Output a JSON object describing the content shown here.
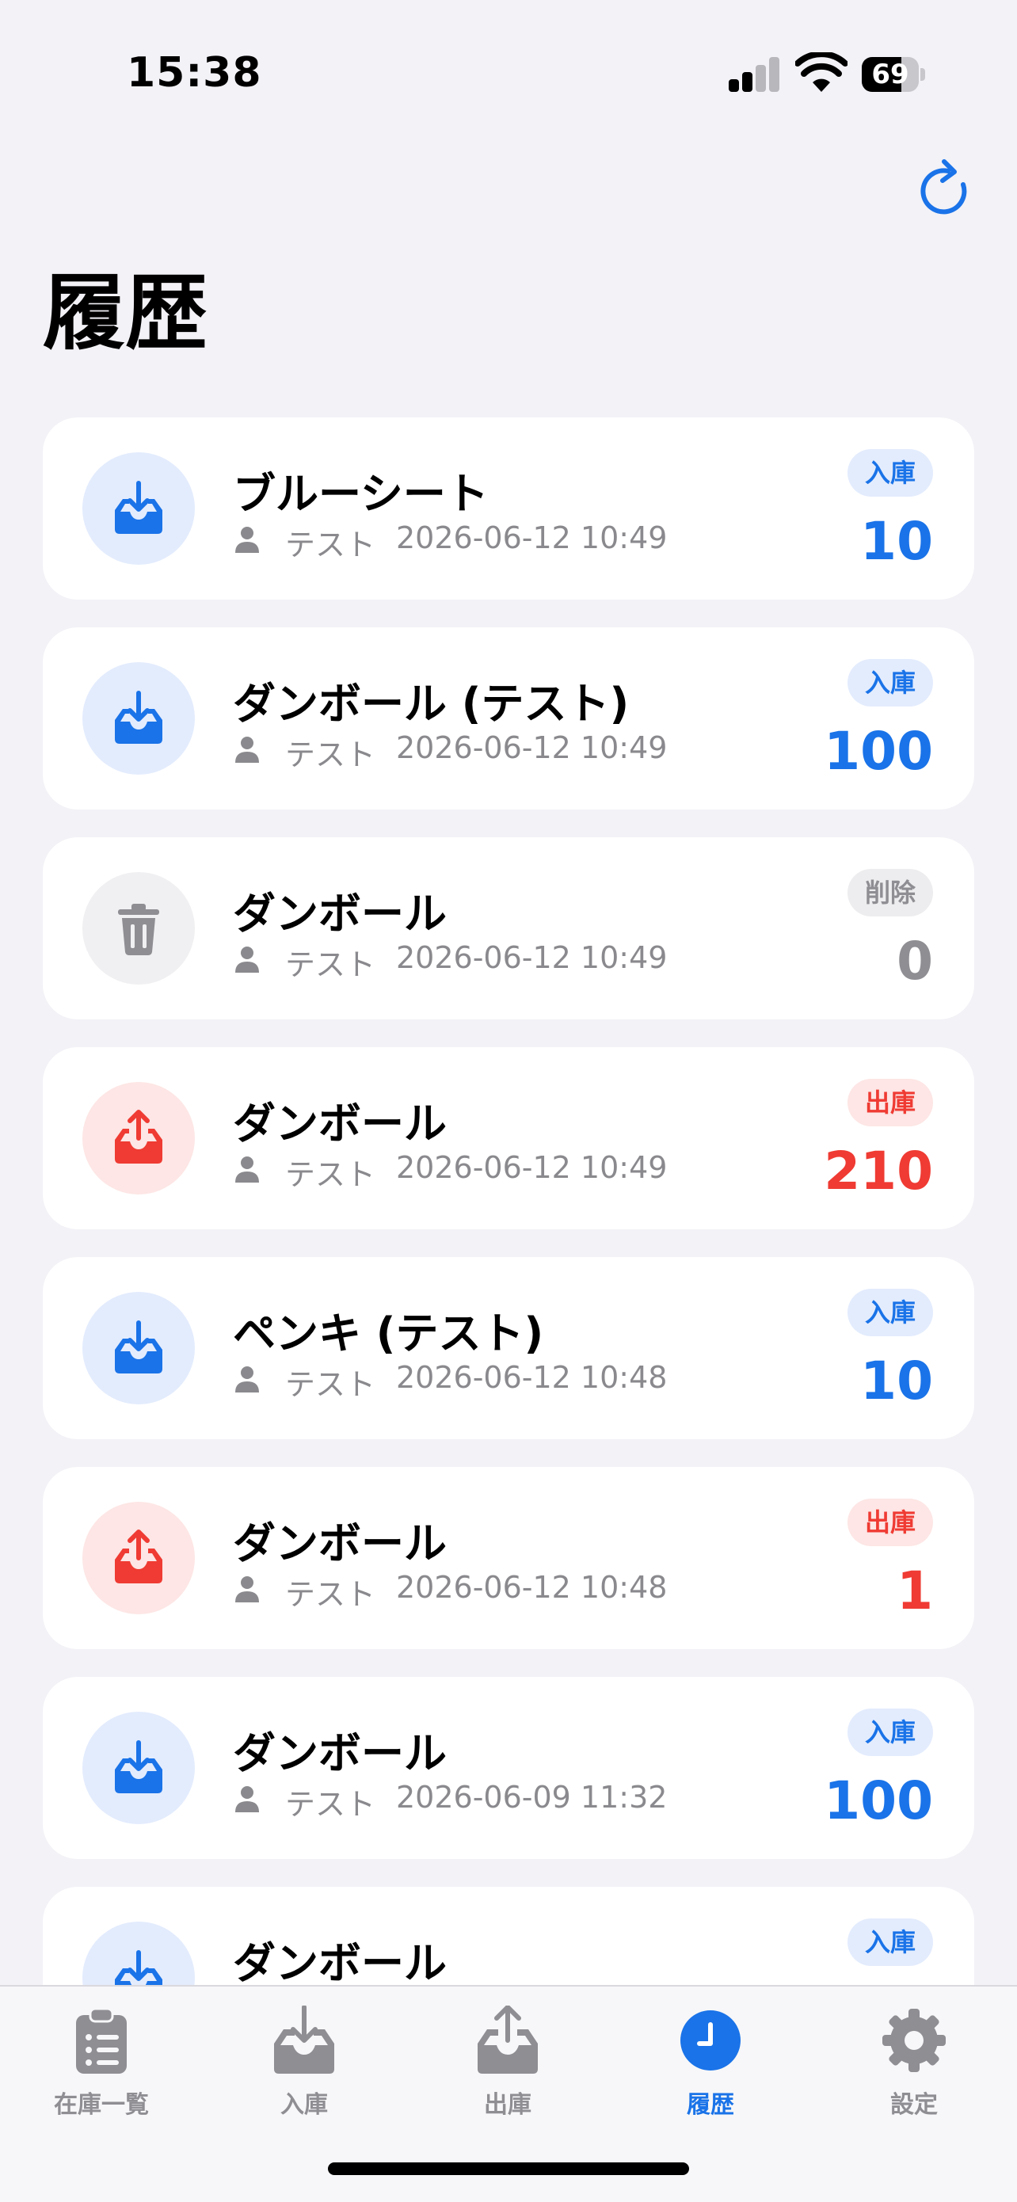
{
  "status_bar": {
    "time": "15:38",
    "battery": "69",
    "battery_level": 0.69
  },
  "page": {
    "title": "履歴"
  },
  "colors": {
    "accent": "#1a73e8",
    "in": "#1a73e8",
    "out": "#ef3b33",
    "deleted": "#8e8e93"
  },
  "history": [
    {
      "type": "in",
      "icon": "inbox-download-icon",
      "name": "ブルーシート",
      "user": "テスト",
      "datetime": "2026-06-12 10:49",
      "badge": "入庫",
      "quantity": "10"
    },
    {
      "type": "in",
      "icon": "inbox-download-icon",
      "name": "ダンボール (テスト)",
      "user": "テスト",
      "datetime": "2026-06-12 10:49",
      "badge": "入庫",
      "quantity": "100"
    },
    {
      "type": "del",
      "icon": "trash-icon",
      "name": "ダンボール",
      "user": "テスト",
      "datetime": "2026-06-12 10:49",
      "badge": "削除",
      "quantity": "0"
    },
    {
      "type": "out",
      "icon": "inbox-upload-icon",
      "name": "ダンボール",
      "user": "テスト",
      "datetime": "2026-06-12 10:49",
      "badge": "出庫",
      "quantity": "210"
    },
    {
      "type": "in",
      "icon": "inbox-download-icon",
      "name": "ペンキ (テスト)",
      "user": "テスト",
      "datetime": "2026-06-12 10:48",
      "badge": "入庫",
      "quantity": "10"
    },
    {
      "type": "out",
      "icon": "inbox-upload-icon",
      "name": "ダンボール",
      "user": "テスト",
      "datetime": "2026-06-12 10:48",
      "badge": "出庫",
      "quantity": "1"
    },
    {
      "type": "in",
      "icon": "inbox-download-icon",
      "name": "ダンボール",
      "user": "テスト",
      "datetime": "2026-06-09 11:32",
      "badge": "入庫",
      "quantity": "100"
    },
    {
      "type": "in",
      "icon": "inbox-download-icon",
      "name": "ダンボール",
      "user": "",
      "datetime": "",
      "badge": "入庫",
      "quantity": ""
    }
  ],
  "tabs": [
    {
      "label": "在庫一覧",
      "icon": "clipboard-list-icon",
      "active": false
    },
    {
      "label": "入庫",
      "icon": "tray-download-icon",
      "active": false
    },
    {
      "label": "出庫",
      "icon": "tray-upload-icon",
      "active": false
    },
    {
      "label": "履歴",
      "icon": "clock-icon",
      "active": true
    },
    {
      "label": "設定",
      "icon": "gear-icon",
      "active": false
    }
  ]
}
